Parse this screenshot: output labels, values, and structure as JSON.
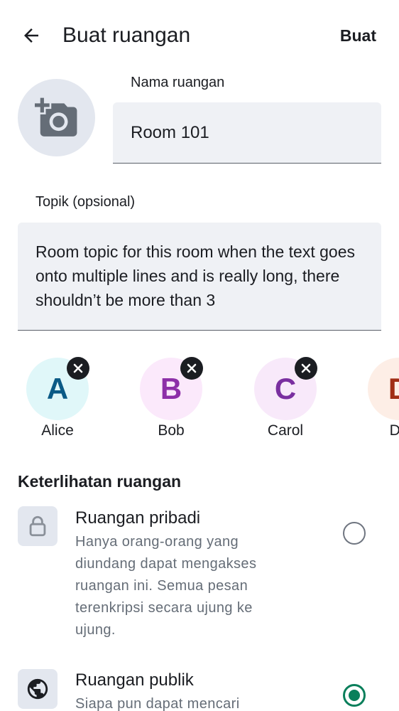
{
  "header": {
    "title": "Buat ruangan",
    "create_label": "Buat",
    "back_icon": "arrow-left-icon"
  },
  "avatar_picker": {
    "icon": "add-photo-camera-icon"
  },
  "name_field": {
    "label": "Nama ruangan",
    "value": "Room 101"
  },
  "topic_field": {
    "label": "Topik (opsional)",
    "value": "Room topic for this room when the text goes onto multiple lines and is really long, there shouldn’t be more than 3"
  },
  "members": [
    {
      "initial": "A",
      "name": "Alice",
      "bg": "#e0f7f9",
      "fg": "#0b5a86"
    },
    {
      "initial": "B",
      "name": "Bob",
      "bg": "#fbe9fb",
      "fg": "#8d2fa8"
    },
    {
      "initial": "C",
      "name": "Carol",
      "bg": "#f8e9fa",
      "fg": "#7a2fa0"
    },
    {
      "initial": "D",
      "name": "Da",
      "bg": "#fdeee6",
      "fg": "#a12e15"
    }
  ],
  "visibility": {
    "title": "Keterlihatan ruangan",
    "options": [
      {
        "title": "Ruangan pribadi",
        "description_lines": [
          "Hanya orang-orang yang",
          "diundang dapat mengakses",
          "ruangan ini. Semua pesan",
          "terenkripsi secara ujung ke",
          "ujung."
        ],
        "icon": "lock-icon",
        "selected": false
      },
      {
        "title": "Ruangan publik",
        "description_lines": [
          "Siapa pun dapat mencari"
        ],
        "icon": "globe-icon",
        "selected": true
      }
    ]
  },
  "colors": {
    "accent": "#0a7f5b",
    "field_background": "#eff1f5",
    "icon_background": "#e3e7ef",
    "secondary_text": "#656d77"
  }
}
